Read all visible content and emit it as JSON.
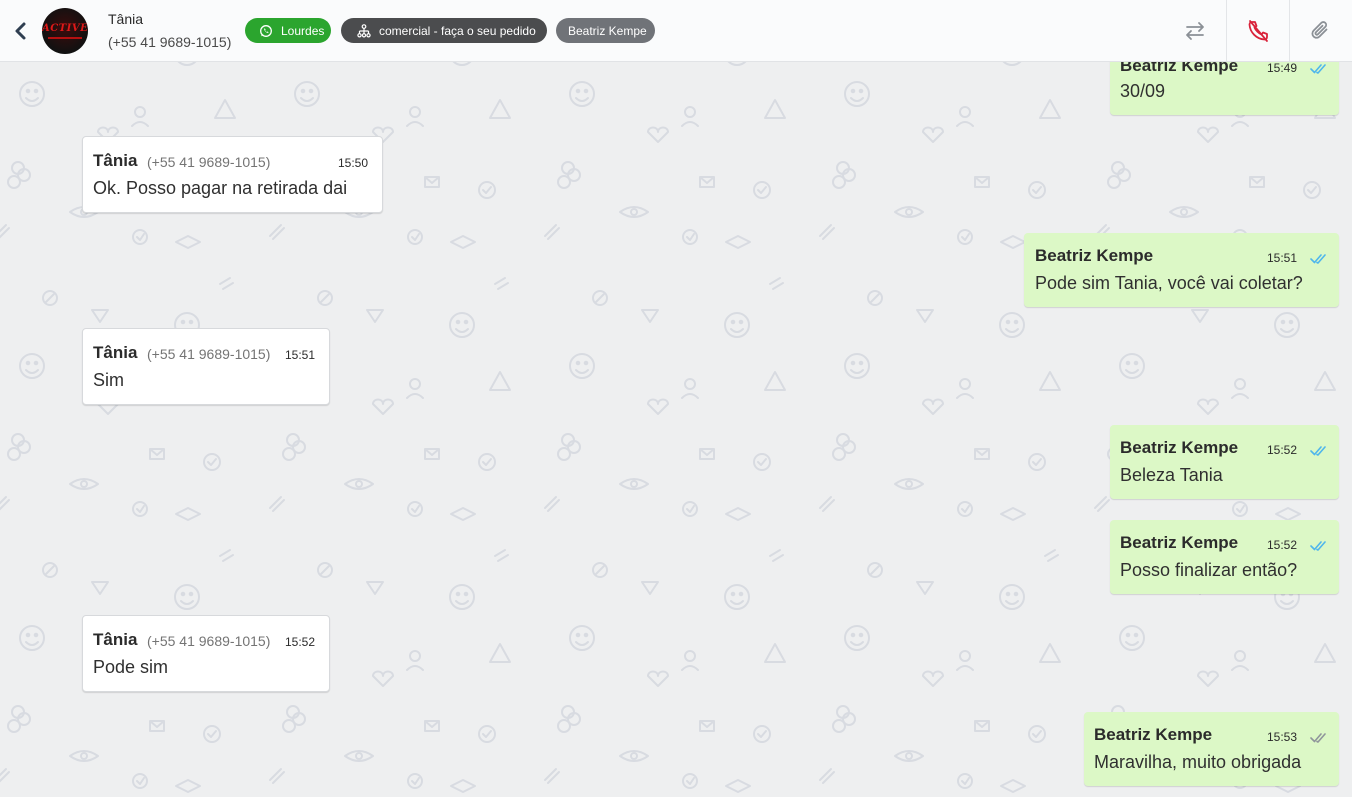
{
  "header": {
    "contact_name": "Tânia",
    "contact_phone": "(+55 41 9689-1015)",
    "avatar_logo": "ACTIVE",
    "tags": {
      "whatsapp": "Lourdes",
      "queue": "comercial - faça o seu pedido",
      "agent": "Beatriz Kempe"
    },
    "icons": {
      "back": "chevron-left-icon",
      "transfer": "arrows-swap-icon",
      "hangup": "phone-off-icon",
      "attach": "paperclip-icon"
    }
  },
  "colors": {
    "whatsapp_tag": "#2ba52e",
    "queue_tag": "#4b4c4e",
    "agent_tag": "#707378",
    "outgoing_bubble": "#dcf8c6",
    "incoming_bubble": "#ffffff",
    "read_tick": "#4fb6ec",
    "delivered_tick": "#8f959b",
    "hangup_icon": "#d9223a"
  },
  "messages": [
    {
      "direction": "out",
      "sender": "Beatriz Kempe",
      "time": "15:49",
      "text": "30/09",
      "status": "read"
    },
    {
      "direction": "in",
      "sender": "Tânia",
      "phone": "(+55 41 9689-1015)",
      "time": "15:50",
      "text": "Ok. Posso pagar na retirada dai"
    },
    {
      "direction": "out",
      "sender": "Beatriz Kempe",
      "time": "15:51",
      "text": "Pode sim Tania, você vai coletar?",
      "status": "read"
    },
    {
      "direction": "in",
      "sender": "Tânia",
      "phone": "(+55 41 9689-1015)",
      "time": "15:51",
      "text": "Sim"
    },
    {
      "direction": "out",
      "sender": "Beatriz Kempe",
      "time": "15:52",
      "text": "Beleza Tania",
      "status": "read"
    },
    {
      "direction": "out",
      "sender": "Beatriz Kempe",
      "time": "15:52",
      "text": "Posso finalizar então?",
      "status": "read"
    },
    {
      "direction": "in",
      "sender": "Tânia",
      "phone": "(+55 41 9689-1015)",
      "time": "15:52",
      "text": "Pode sim"
    },
    {
      "direction": "out",
      "sender": "Beatriz Kempe",
      "time": "15:53",
      "text": "Maravilha, muito obrigada",
      "status": "delivered"
    }
  ]
}
